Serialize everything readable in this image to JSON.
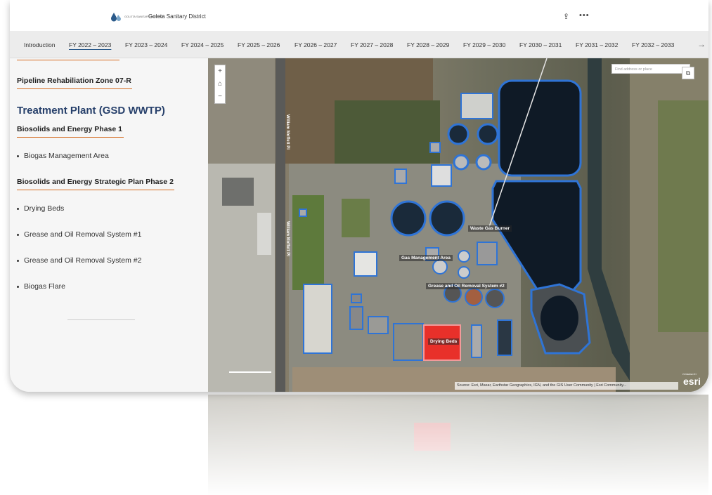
{
  "header": {
    "org_small": "GOLETA SANITARY DISTRICT",
    "title": "Goleta Sanitary District",
    "share_icon": "share-icon",
    "more_icon": "more-icon"
  },
  "nav": {
    "items": [
      {
        "label": "Introduction"
      },
      {
        "label": "FY 2022 – 2023"
      },
      {
        "label": "FY 2023 – 2024"
      },
      {
        "label": "FY 2024 – 2025"
      },
      {
        "label": "FY 2025 – 2026"
      },
      {
        "label": "FY 2026 – 2027"
      },
      {
        "label": "FY 2027 – 2028"
      },
      {
        "label": "FY 2028 – 2029"
      },
      {
        "label": "FY 2029 – 2030"
      },
      {
        "label": "FY 2030 – 2031"
      },
      {
        "label": "FY 2031 – 2032"
      },
      {
        "label": "FY 2032 – 2033"
      }
    ],
    "active": "FY 2022 – 2023",
    "next_arrow": "→"
  },
  "sidebar": {
    "heading_pipeline": "Pipeline Rehabiliation Zone 07-R",
    "heading_plant": "Treatment Plant (GSD WWTP)",
    "heading_phase1": "Biosolids and Energy Phase 1",
    "item_biogas_mgmt": "Biogas Management Area",
    "heading_phase2": "Biosolids and Energy Strategic Plan Phase 2",
    "item_drying": "Drying Beds",
    "item_grease1": "Grease and Oil Removal System #1",
    "item_grease2": "Grease and Oil Removal System #2",
    "item_flare": "Biogas Flare"
  },
  "map": {
    "search_placeholder": "Find address or place",
    "zoom_in": "+",
    "home": "⌂",
    "zoom_out": "−",
    "road_label_1": "William Moffett Pl",
    "road_label_2": "William Moffett Pl",
    "label_waste_gas": "Waste Gas Burner",
    "label_gas_mgmt": "Gas Management Area",
    "label_grease2": "Grease and Oil Removal System #2",
    "label_drying": "Drying Beds",
    "attribution": "Source: Esri, Maxar, Earthstar Geographics, IGN, and the GIS User Community | Esri Community...",
    "esri": "esri",
    "powered_by": "POWERED BY",
    "highlight_color": "#2f74d6",
    "selected_color": "#e8302a"
  }
}
